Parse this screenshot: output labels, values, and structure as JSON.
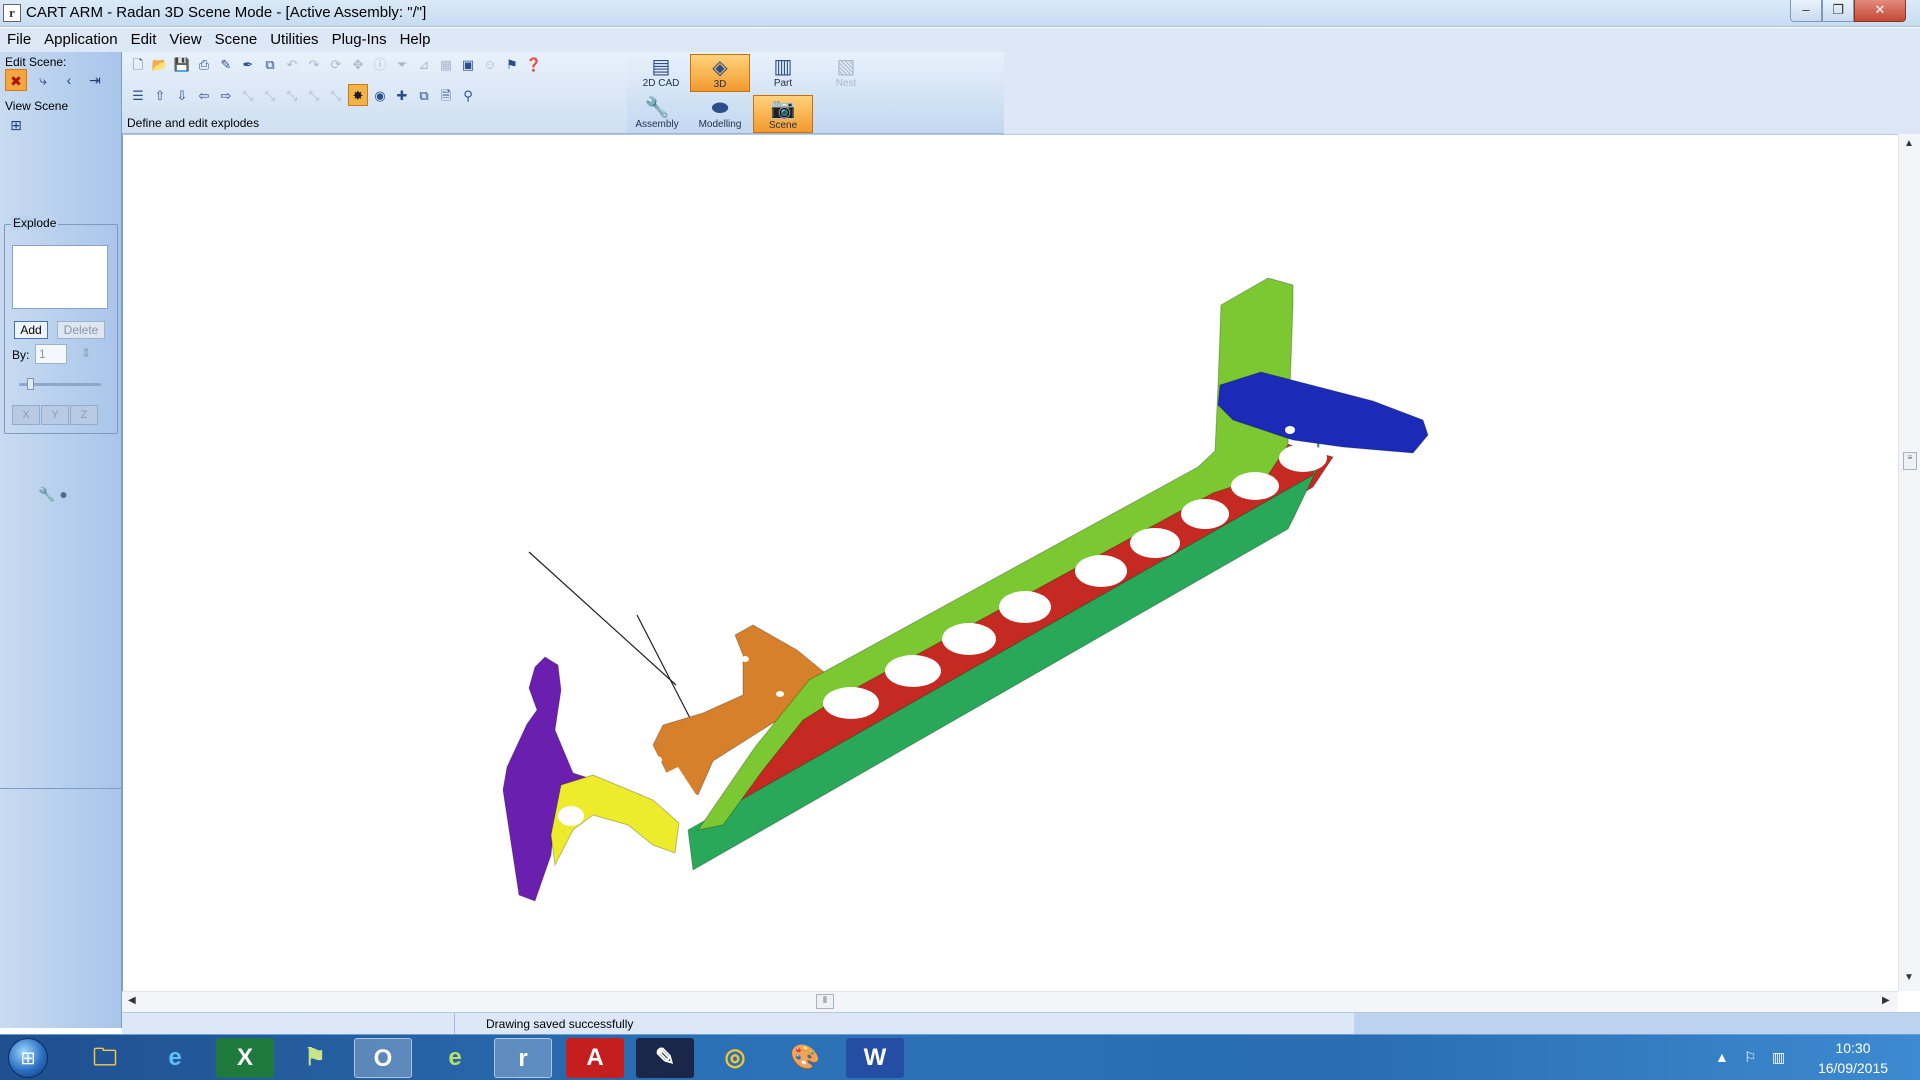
{
  "window": {
    "title": "CART ARM - Radan 3D Scene Mode - [Active Assembly: \"/\"]",
    "app_icon_glyph": "r",
    "minimize_glyph": "–",
    "maximize_glyph": "❐",
    "close_glyph": "✕"
  },
  "menu": [
    "File",
    "Application",
    "Edit",
    "View",
    "Scene",
    "Utilities",
    "Plug-Ins",
    "Help"
  ],
  "left_panel": {
    "edit_scene_label": "Edit Scene:",
    "view_scene_label": "View Scene",
    "explode": {
      "legend": "Explode",
      "add_label": "Add",
      "delete_label": "Delete",
      "by_label": "By:",
      "by_value": "1",
      "slider_fraction": 0.1,
      "axis_buttons": [
        "X",
        "Y",
        "Z"
      ]
    }
  },
  "toolbar": {
    "status_hint": "Define and edit explodes",
    "row1_icons": [
      "new-icon",
      "open-icon",
      "save-icon",
      "print-icon",
      "pencil-icon",
      "pen-tool-icon",
      "copy-icon",
      "undo-icon",
      "redo-icon",
      "rotate-icon",
      "move-icon",
      "info-icon",
      "filter-icon",
      "measure-icon",
      "grid-icon",
      "select-icon",
      "user-icon",
      "pin-icon",
      "help-icon"
    ],
    "row2_icons": [
      "list-icon",
      "arrow-up-icon",
      "arrow-down-icon",
      "arrow-left-icon",
      "arrow-right-icon",
      "align-icon",
      "align-icon",
      "align-icon",
      "align-icon",
      "align-icon",
      "explode-icon",
      "target-icon",
      "move-cross-icon",
      "copy-icon",
      "page-icon",
      "eyedropper-icon"
    ]
  },
  "modes": {
    "cad2d": "2D CAD",
    "three_d": "3D",
    "part": "Part",
    "nest": "Nest",
    "assembly": "Assembly",
    "modelling": "Modelling",
    "scene": "Scene"
  },
  "status": {
    "message": "Drawing saved successfully"
  },
  "taskbar": {
    "apps": [
      "explorer",
      "internet-explorer",
      "excel",
      "maps",
      "outlook",
      "edge",
      "radan",
      "acrobat",
      "tool",
      "chrome",
      "paint",
      "word"
    ],
    "time": "10:30",
    "date": "16/09/2015"
  },
  "colors": {
    "part_green_light": "#7cc832",
    "part_green_dark": "#2aa85a",
    "part_red": "#c42a22",
    "part_blue": "#1c2ab8",
    "part_orange": "#d7802c",
    "part_purple": "#6a1fae",
    "part_yellow": "#ecec2c",
    "accent_orange": "#f39a2e"
  }
}
